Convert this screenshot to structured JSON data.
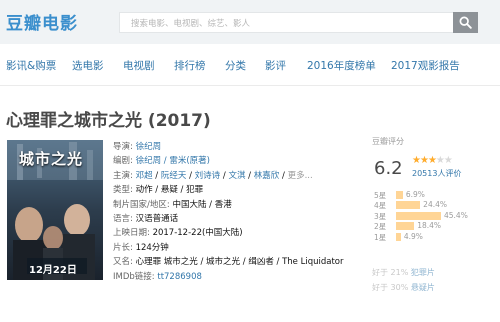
{
  "header": {
    "logo": "豆瓣电影",
    "search_placeholder": "搜索电影、电视剧、综艺、影人"
  },
  "nav": {
    "items": [
      "影讯&购票",
      "选电影",
      "电视剧",
      "排行榜",
      "分类",
      "影评",
      "2016年度榜单",
      "2017观影报告"
    ]
  },
  "movie": {
    "title": "心理罪之城市之光 (2017)",
    "poster": {
      "title_text": "城市之光",
      "release_text": "12月22日"
    },
    "info": {
      "director_label": "导演:",
      "director": "徐纪周",
      "writer_label": "编剧:",
      "writers": "徐纪周 / 雷米(原著)",
      "cast_label": "主演:",
      "cast": [
        "邓超",
        "阮经天",
        "刘诗诗",
        "文淇",
        "林嘉欣",
        "更多..."
      ],
      "genre_label": "类型:",
      "genres": "动作 / 悬疑 / 犯罪",
      "country_label": "制片国家/地区:",
      "country": "中国大陆 / 香港",
      "language_label": "语言:",
      "language": "汉语普通话",
      "release_label": "上映日期:",
      "release": "2017-12-22(中国大陆)",
      "runtime_label": "片长:",
      "runtime": "124分钟",
      "aka_label": "又名:",
      "aka": "心理罪 城市之光 / 城市之光 / 缉凶者 / The Liquidator",
      "imdb_label": "IMDb链接:",
      "imdb": "tt7286908"
    }
  },
  "rating": {
    "label": "豆瓣评分",
    "score": "6.2",
    "stars_filled": 3,
    "stars_total": 5,
    "votes": "20513人评价",
    "bars": [
      {
        "label": "5星",
        "pct": "6.9%",
        "value": 6.9
      },
      {
        "label": "4星",
        "pct": "24.4%",
        "value": 24.4
      },
      {
        "label": "3星",
        "pct": "45.4%",
        "value": 45.4
      },
      {
        "label": "2星",
        "pct": "18.4%",
        "value": 18.4
      },
      {
        "label": "1星",
        "pct": "4.9%",
        "value": 4.9
      }
    ],
    "compare": [
      {
        "prefix": "好于",
        "value": "21%",
        "category": "犯罪片"
      },
      {
        "prefix": "好于",
        "value": "30%",
        "category": "悬疑片"
      }
    ]
  },
  "colors": {
    "brand": "#3b8fcd",
    "link": "#3377aa",
    "star": "#ffac2d",
    "bar": "#ffd596"
  }
}
